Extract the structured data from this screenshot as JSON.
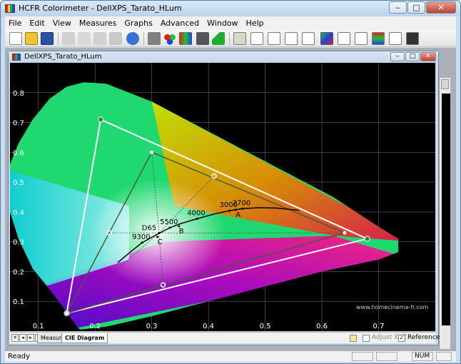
{
  "window": {
    "title": "HCFR Colorimeter - DellXPS_Tarato_HLum"
  },
  "menu": [
    "File",
    "Edit",
    "View",
    "Measures",
    "Graphs",
    "Advanced",
    "Window",
    "Help"
  ],
  "toolbar": {
    "icons": [
      "new-file-icon",
      "open-folder-icon",
      "save-icon",
      "cut-icon",
      "copy-icon",
      "paste-icon",
      "print-icon",
      "help-icon",
      "generator-icon",
      "colors-icon",
      "patterns-icon",
      "camera-icon",
      "play-icon",
      "view1-icon",
      "view2-icon",
      "view3-icon",
      "view4-icon",
      "view5-icon",
      "cie-view-icon",
      "view7-icon",
      "view8-icon",
      "view9-icon",
      "view10-icon",
      "view11-icon"
    ]
  },
  "document": {
    "title": "DellXPS_Tarato_HLum"
  },
  "chart_data": {
    "type": "scatter",
    "title": "",
    "xlabel": "",
    "ylabel": "",
    "xlim": [
      0.05,
      0.8
    ],
    "ylim": [
      0.0,
      0.9
    ],
    "grid": true,
    "xticks": [
      "0.1",
      "0.2",
      "0.3",
      "0.4",
      "0.5",
      "0.6",
      "0.7"
    ],
    "yticks": [
      "0.1",
      "0.2",
      "0.3",
      "0.4",
      "0.5",
      "0.6",
      "0.7",
      "0.8"
    ],
    "reference_gamut": [
      [
        0.64,
        0.33
      ],
      [
        0.3,
        0.6
      ],
      [
        0.15,
        0.06
      ]
    ],
    "measured_gamut": [
      [
        0.68,
        0.31
      ],
      [
        0.21,
        0.71
      ],
      [
        0.15,
        0.06
      ]
    ],
    "secondaries": [
      [
        0.41,
        0.52
      ],
      [
        0.225,
        0.33
      ],
      [
        0.32,
        0.155
      ]
    ],
    "white_points": [
      {
        "label": "D65",
        "x": 0.3127,
        "y": 0.329
      },
      {
        "label": "B",
        "x": 0.348,
        "y": 0.352
      },
      {
        "label": "C",
        "x": 0.31,
        "y": 0.316
      },
      {
        "label": "A",
        "x": 0.448,
        "y": 0.407
      }
    ],
    "cct_labels": [
      {
        "label": "9300",
        "x": 0.283,
        "y": 0.297
      },
      {
        "label": "5500",
        "x": 0.332,
        "y": 0.347
      },
      {
        "label": "4000",
        "x": 0.38,
        "y": 0.377
      },
      {
        "label": "3000",
        "x": 0.437,
        "y": 0.404
      },
      {
        "label": "2700",
        "x": 0.46,
        "y": 0.411
      }
    ],
    "planckian": [
      [
        0.24,
        0.23
      ],
      [
        0.265,
        0.27
      ],
      [
        0.283,
        0.297
      ],
      [
        0.31,
        0.325
      ],
      [
        0.332,
        0.347
      ],
      [
        0.35,
        0.36
      ],
      [
        0.38,
        0.377
      ],
      [
        0.41,
        0.393
      ],
      [
        0.437,
        0.404
      ],
      [
        0.46,
        0.411
      ],
      [
        0.49,
        0.414
      ],
      [
        0.52,
        0.413
      ],
      [
        0.56,
        0.405
      ]
    ],
    "watermark": "www.homecinema-fr.com"
  },
  "bottom": {
    "tabs": [
      "Measures",
      "CIE Diagram"
    ],
    "adjust_xyz_label": "Adjust XYZ",
    "reference_label": "Reference",
    "reference_checked": "✓"
  },
  "status": {
    "text": "Ready",
    "num": "NUM"
  }
}
